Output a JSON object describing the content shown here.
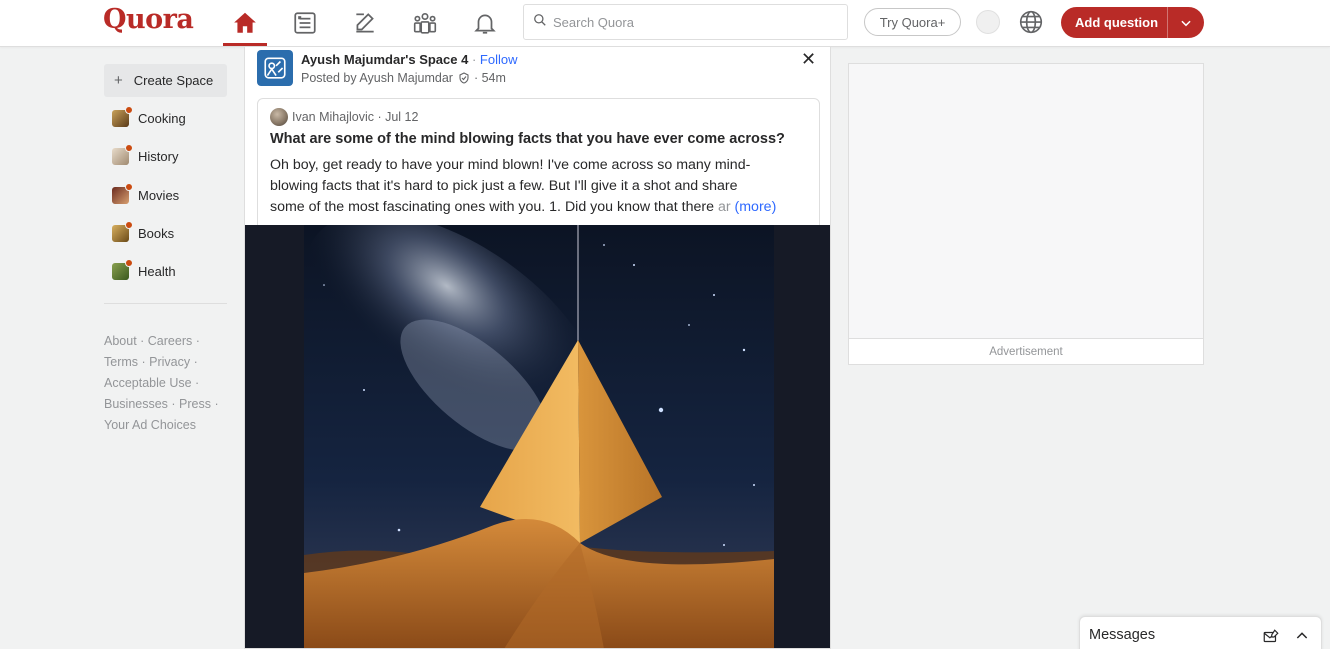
{
  "header": {
    "logo": "Quora",
    "search_placeholder": "Search Quora",
    "try_plus": "Try Quora+",
    "add_question": "Add question",
    "nav_icons": [
      "home-icon",
      "following-icon",
      "answer-icon",
      "spaces-icon",
      "notifications-icon"
    ],
    "accent_color": "#b92b27"
  },
  "sidebar": {
    "create_space": "Create Space",
    "spaces": [
      {
        "label": "Cooking",
        "color": "#7a5a1e"
      },
      {
        "label": "History",
        "color": "#c8b7a3"
      },
      {
        "label": "Movies",
        "color": "#8a3a2a"
      },
      {
        "label": "Books",
        "color": "#9a6a2a"
      },
      {
        "label": "Health",
        "color": "#5a7a2e"
      }
    ],
    "footer": {
      "about": "About",
      "careers": "Careers",
      "terms": "Terms",
      "privacy": "Privacy",
      "acceptable_use": "Acceptable Use",
      "businesses": "Businesses",
      "press": "Press",
      "ad_choices": "Your Ad Choices"
    }
  },
  "post": {
    "space_name": "Ayush Majumdar's Space 4",
    "follow": "Follow",
    "posted_by": "Posted by Ayush Majumdar",
    "time": "· 54m",
    "shared": {
      "author": "Ivan Mihajlovic",
      "date": "· Jul 12",
      "question": "What are some of the mind blowing facts that you have ever come across?",
      "answer_line1": "Oh boy, get ready to have your mind blown! I've come across so many mind-",
      "answer_line2": "blowing facts that it's hard to pick just a few. But I'll give it a shot and share",
      "answer_line3": "some of the most fascinating ones with you. 1. Did you know that there ",
      "answer_fade": "ar",
      "more": "(more)"
    }
  },
  "ad": {
    "label": "Advertisement"
  },
  "messages": {
    "label": "Messages"
  }
}
